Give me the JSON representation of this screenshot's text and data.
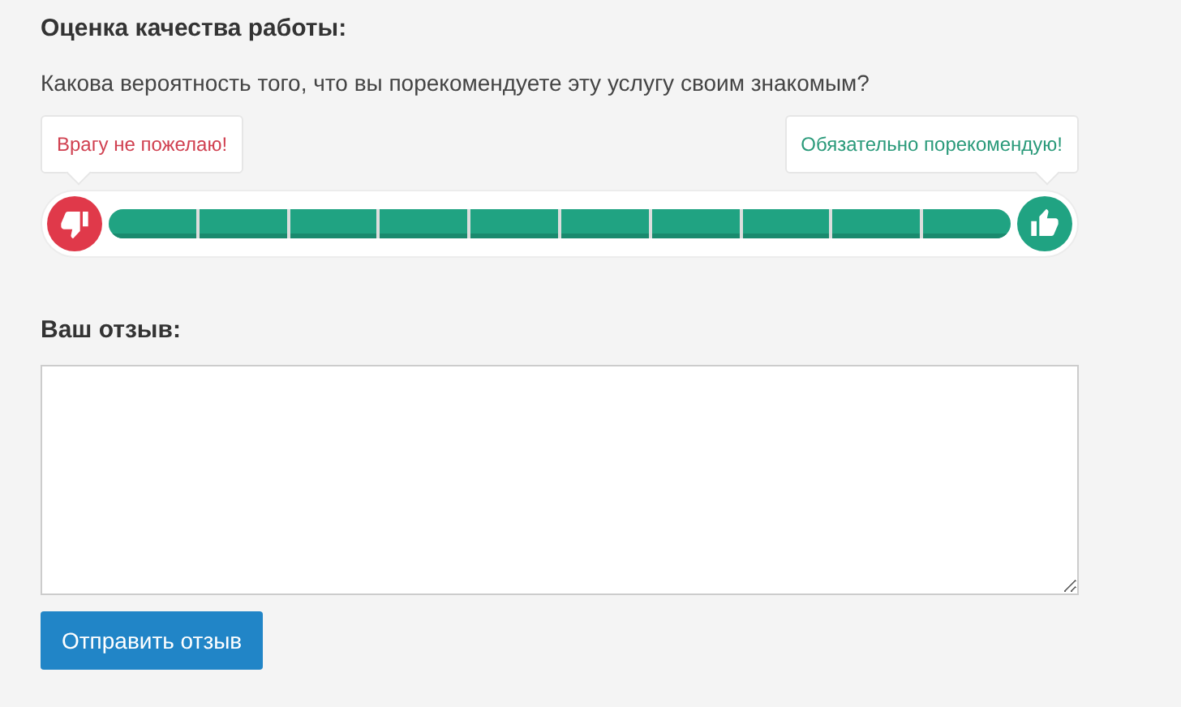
{
  "section_title": "Оценка качества работы:",
  "question": "Какова вероятность того, что вы порекомендуете эту услугу своим знакомым?",
  "rating": {
    "low_label": "Врагу не пожелаю!",
    "high_label": "Обязательно порекомендую!",
    "segments": [
      {
        "filled": true
      },
      {
        "filled": true
      },
      {
        "filled": true
      },
      {
        "filled": true
      },
      {
        "filled": true
      },
      {
        "filled": true
      },
      {
        "filled": true
      },
      {
        "filled": true
      },
      {
        "filled": true
      },
      {
        "filled": true
      }
    ]
  },
  "review_label": "Ваш отзыв:",
  "submit_button": "Отправить отзыв"
}
